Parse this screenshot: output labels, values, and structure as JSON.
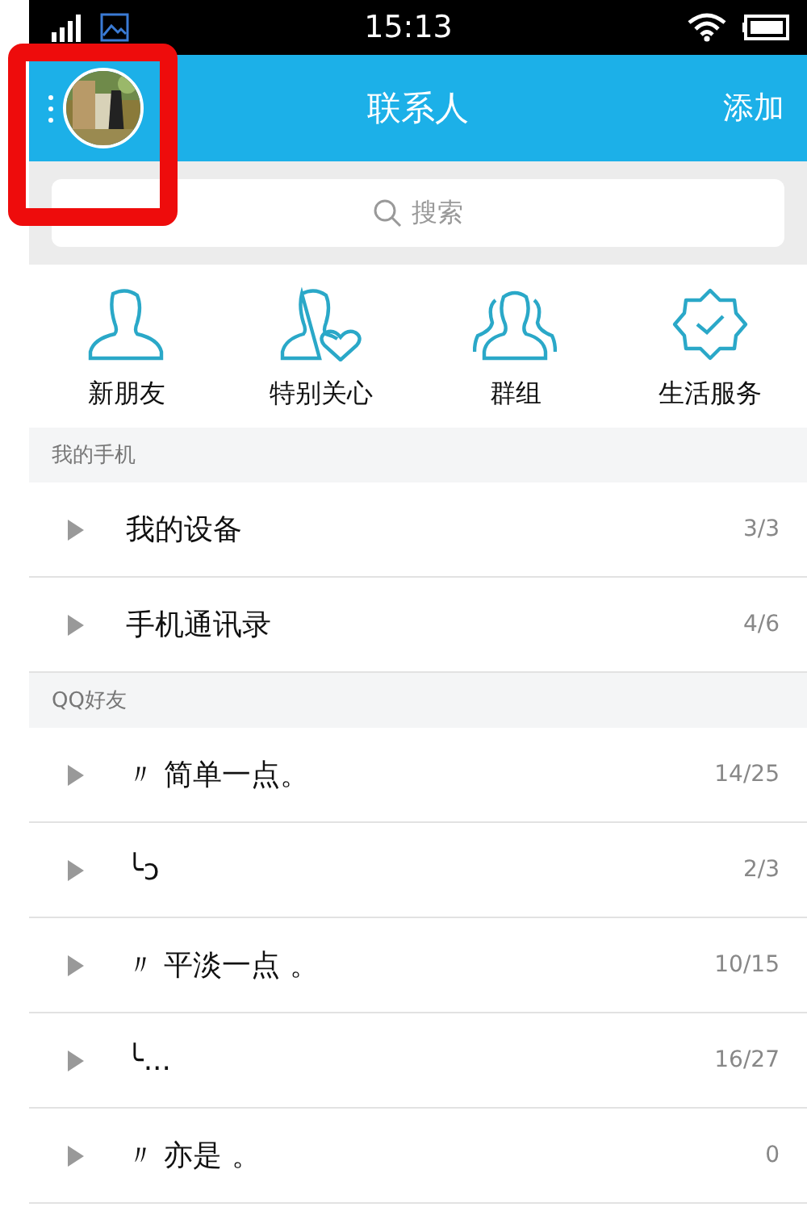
{
  "status_bar": {
    "time": "15:13"
  },
  "header": {
    "title": "联系人",
    "action": "添加"
  },
  "search": {
    "placeholder": "搜索"
  },
  "shortcuts": [
    {
      "kind": "person",
      "label": "新朋友"
    },
    {
      "kind": "heart",
      "label": "特别关心"
    },
    {
      "kind": "group",
      "label": "群组"
    },
    {
      "kind": "badge",
      "label": "生活服务"
    }
  ],
  "sections": [
    {
      "title": "我的手机",
      "items": [
        {
          "name": "我的设备",
          "count": "3/3",
          "expanded": false
        },
        {
          "name": "手机通讯录",
          "count": "4/6",
          "expanded": false
        }
      ]
    },
    {
      "title": "QQ好友",
      "items": [
        {
          "name": "〃 简单一点。",
          "count": "14/25",
          "expanded": false
        },
        {
          "name": "╰ɔ",
          "count": "2/3",
          "expanded": false
        },
        {
          "name": "〃 平淡一点 。",
          "count": "10/15",
          "expanded": false
        },
        {
          "name": "╰...",
          "count": "16/27",
          "expanded": false
        },
        {
          "name": "〃 亦是 。",
          "count": "0",
          "expanded": false
        }
      ]
    }
  ]
}
